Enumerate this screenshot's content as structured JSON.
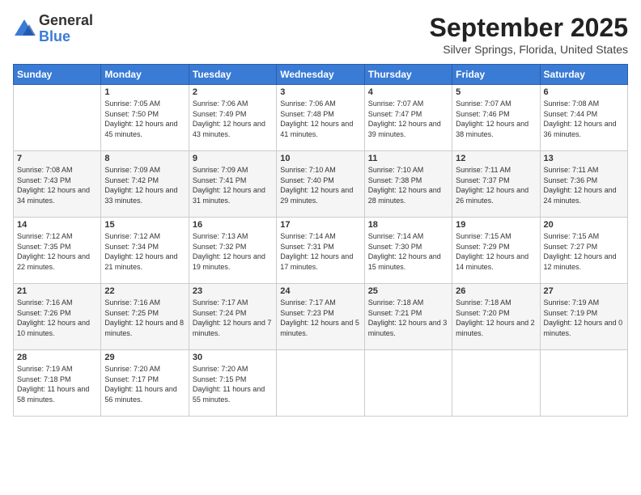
{
  "logo": {
    "general": "General",
    "blue": "Blue"
  },
  "title": "September 2025",
  "location": "Silver Springs, Florida, United States",
  "headers": [
    "Sunday",
    "Monday",
    "Tuesday",
    "Wednesday",
    "Thursday",
    "Friday",
    "Saturday"
  ],
  "weeks": [
    [
      {
        "day": "",
        "sunrise": "",
        "sunset": "",
        "daylight": "",
        "empty": true
      },
      {
        "day": "1",
        "sunrise": "Sunrise: 7:05 AM",
        "sunset": "Sunset: 7:50 PM",
        "daylight": "Daylight: 12 hours and 45 minutes."
      },
      {
        "day": "2",
        "sunrise": "Sunrise: 7:06 AM",
        "sunset": "Sunset: 7:49 PM",
        "daylight": "Daylight: 12 hours and 43 minutes."
      },
      {
        "day": "3",
        "sunrise": "Sunrise: 7:06 AM",
        "sunset": "Sunset: 7:48 PM",
        "daylight": "Daylight: 12 hours and 41 minutes."
      },
      {
        "day": "4",
        "sunrise": "Sunrise: 7:07 AM",
        "sunset": "Sunset: 7:47 PM",
        "daylight": "Daylight: 12 hours and 39 minutes."
      },
      {
        "day": "5",
        "sunrise": "Sunrise: 7:07 AM",
        "sunset": "Sunset: 7:46 PM",
        "daylight": "Daylight: 12 hours and 38 minutes."
      },
      {
        "day": "6",
        "sunrise": "Sunrise: 7:08 AM",
        "sunset": "Sunset: 7:44 PM",
        "daylight": "Daylight: 12 hours and 36 minutes."
      }
    ],
    [
      {
        "day": "7",
        "sunrise": "Sunrise: 7:08 AM",
        "sunset": "Sunset: 7:43 PM",
        "daylight": "Daylight: 12 hours and 34 minutes."
      },
      {
        "day": "8",
        "sunrise": "Sunrise: 7:09 AM",
        "sunset": "Sunset: 7:42 PM",
        "daylight": "Daylight: 12 hours and 33 minutes."
      },
      {
        "day": "9",
        "sunrise": "Sunrise: 7:09 AM",
        "sunset": "Sunset: 7:41 PM",
        "daylight": "Daylight: 12 hours and 31 minutes."
      },
      {
        "day": "10",
        "sunrise": "Sunrise: 7:10 AM",
        "sunset": "Sunset: 7:40 PM",
        "daylight": "Daylight: 12 hours and 29 minutes."
      },
      {
        "day": "11",
        "sunrise": "Sunrise: 7:10 AM",
        "sunset": "Sunset: 7:38 PM",
        "daylight": "Daylight: 12 hours and 28 minutes."
      },
      {
        "day": "12",
        "sunrise": "Sunrise: 7:11 AM",
        "sunset": "Sunset: 7:37 PM",
        "daylight": "Daylight: 12 hours and 26 minutes."
      },
      {
        "day": "13",
        "sunrise": "Sunrise: 7:11 AM",
        "sunset": "Sunset: 7:36 PM",
        "daylight": "Daylight: 12 hours and 24 minutes."
      }
    ],
    [
      {
        "day": "14",
        "sunrise": "Sunrise: 7:12 AM",
        "sunset": "Sunset: 7:35 PM",
        "daylight": "Daylight: 12 hours and 22 minutes."
      },
      {
        "day": "15",
        "sunrise": "Sunrise: 7:12 AM",
        "sunset": "Sunset: 7:34 PM",
        "daylight": "Daylight: 12 hours and 21 minutes."
      },
      {
        "day": "16",
        "sunrise": "Sunrise: 7:13 AM",
        "sunset": "Sunset: 7:32 PM",
        "daylight": "Daylight: 12 hours and 19 minutes."
      },
      {
        "day": "17",
        "sunrise": "Sunrise: 7:14 AM",
        "sunset": "Sunset: 7:31 PM",
        "daylight": "Daylight: 12 hours and 17 minutes."
      },
      {
        "day": "18",
        "sunrise": "Sunrise: 7:14 AM",
        "sunset": "Sunset: 7:30 PM",
        "daylight": "Daylight: 12 hours and 15 minutes."
      },
      {
        "day": "19",
        "sunrise": "Sunrise: 7:15 AM",
        "sunset": "Sunset: 7:29 PM",
        "daylight": "Daylight: 12 hours and 14 minutes."
      },
      {
        "day": "20",
        "sunrise": "Sunrise: 7:15 AM",
        "sunset": "Sunset: 7:27 PM",
        "daylight": "Daylight: 12 hours and 12 minutes."
      }
    ],
    [
      {
        "day": "21",
        "sunrise": "Sunrise: 7:16 AM",
        "sunset": "Sunset: 7:26 PM",
        "daylight": "Daylight: 12 hours and 10 minutes."
      },
      {
        "day": "22",
        "sunrise": "Sunrise: 7:16 AM",
        "sunset": "Sunset: 7:25 PM",
        "daylight": "Daylight: 12 hours and 8 minutes."
      },
      {
        "day": "23",
        "sunrise": "Sunrise: 7:17 AM",
        "sunset": "Sunset: 7:24 PM",
        "daylight": "Daylight: 12 hours and 7 minutes."
      },
      {
        "day": "24",
        "sunrise": "Sunrise: 7:17 AM",
        "sunset": "Sunset: 7:23 PM",
        "daylight": "Daylight: 12 hours and 5 minutes."
      },
      {
        "day": "25",
        "sunrise": "Sunrise: 7:18 AM",
        "sunset": "Sunset: 7:21 PM",
        "daylight": "Daylight: 12 hours and 3 minutes."
      },
      {
        "day": "26",
        "sunrise": "Sunrise: 7:18 AM",
        "sunset": "Sunset: 7:20 PM",
        "daylight": "Daylight: 12 hours and 2 minutes."
      },
      {
        "day": "27",
        "sunrise": "Sunrise: 7:19 AM",
        "sunset": "Sunset: 7:19 PM",
        "daylight": "Daylight: 12 hours and 0 minutes."
      }
    ],
    [
      {
        "day": "28",
        "sunrise": "Sunrise: 7:19 AM",
        "sunset": "Sunset: 7:18 PM",
        "daylight": "Daylight: 11 hours and 58 minutes."
      },
      {
        "day": "29",
        "sunrise": "Sunrise: 7:20 AM",
        "sunset": "Sunset: 7:17 PM",
        "daylight": "Daylight: 11 hours and 56 minutes."
      },
      {
        "day": "30",
        "sunrise": "Sunrise: 7:20 AM",
        "sunset": "Sunset: 7:15 PM",
        "daylight": "Daylight: 11 hours and 55 minutes."
      },
      {
        "day": "",
        "sunrise": "",
        "sunset": "",
        "daylight": "",
        "empty": true
      },
      {
        "day": "",
        "sunrise": "",
        "sunset": "",
        "daylight": "",
        "empty": true
      },
      {
        "day": "",
        "sunrise": "",
        "sunset": "",
        "daylight": "",
        "empty": true
      },
      {
        "day": "",
        "sunrise": "",
        "sunset": "",
        "daylight": "",
        "empty": true
      }
    ]
  ]
}
